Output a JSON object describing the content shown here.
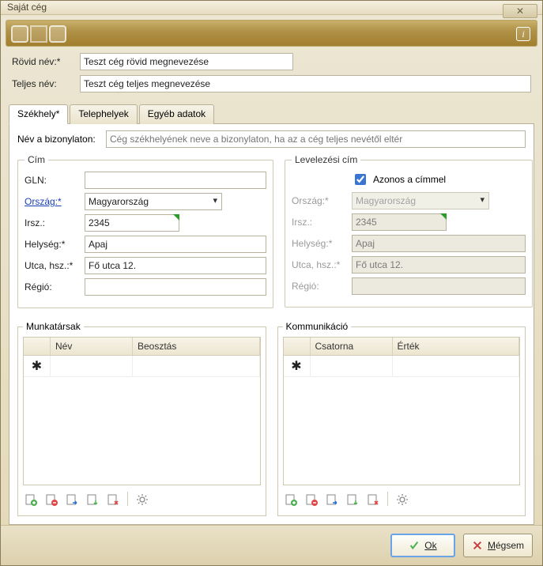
{
  "window": {
    "title": "Saját cég"
  },
  "top": {
    "short_label": "Rövid név:*",
    "short_value": "Teszt cég rövid megnevezése",
    "full_label": "Teljes név:",
    "full_value": "Teszt cég teljes megnevezése"
  },
  "tabs": [
    {
      "label": "Székhely*",
      "active": true
    },
    {
      "label": "Telephelyek",
      "active": false
    },
    {
      "label": "Egyéb adatok",
      "active": false
    }
  ],
  "biz": {
    "label": "Név a bizonylaton:",
    "placeholder": "Cég székhelyének neve a bizonylaton, ha az a cég teljes nevétől eltér"
  },
  "address": {
    "legend": "Cím",
    "gln_label": "GLN:",
    "gln_value": "",
    "country_label": "Ország:*",
    "country_value": "Magyarország",
    "zip_label": "Irsz.:",
    "zip_value": "2345",
    "city_label": "Helység:*",
    "city_value": "Apaj",
    "street_label": "Utca, hsz.:*",
    "street_value": "Fő utca 12.",
    "region_label": "Régió:",
    "region_value": ""
  },
  "mail": {
    "legend": "Levelezési cím",
    "same_label": "Azonos a címmel",
    "same_checked": true,
    "country_label": "Ország:*",
    "country_value": "Magyarország",
    "zip_label": "Irsz.:",
    "zip_value": "2345",
    "city_label": "Helység:*",
    "city_value": "Apaj",
    "street_label": "Utca, hsz.:*",
    "street_value": "Fő utca 12.",
    "region_label": "Régió:",
    "region_value": ""
  },
  "workers": {
    "legend": "Munkatársak",
    "col_name": "Név",
    "col_role": "Beosztás"
  },
  "comm": {
    "legend": "Kommunikáció",
    "col_channel": "Csatorna",
    "col_value": "Érték"
  },
  "icons": {
    "add": "add-icon",
    "remove": "remove-icon",
    "move": "move-icon",
    "import": "import-icon",
    "delete": "delete-icon",
    "settings": "gear-icon"
  },
  "footer": {
    "ok": "Ok",
    "cancel": "Mégsem"
  }
}
